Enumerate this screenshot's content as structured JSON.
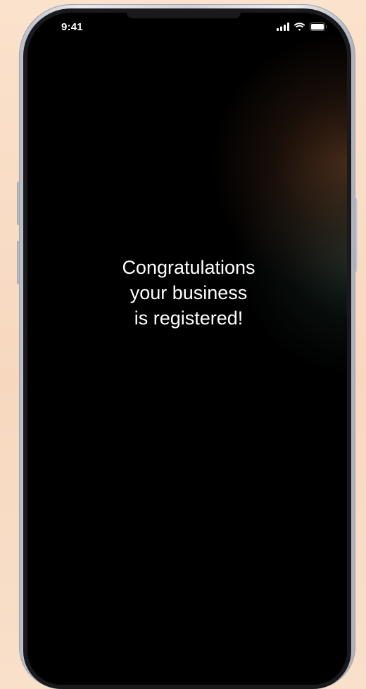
{
  "status_bar": {
    "time": "9:41",
    "icons": [
      "cellular-signal-icon",
      "wifi-icon",
      "battery-icon"
    ]
  },
  "screen": {
    "message_lines": [
      "Congratulations",
      "your business",
      "is registered!"
    ]
  },
  "colors": {
    "background": "#f8dcc3",
    "screen": "#000000",
    "text": "#ffffff",
    "glow_warm": "#784628",
    "glow_cool": "#3c5f55"
  }
}
